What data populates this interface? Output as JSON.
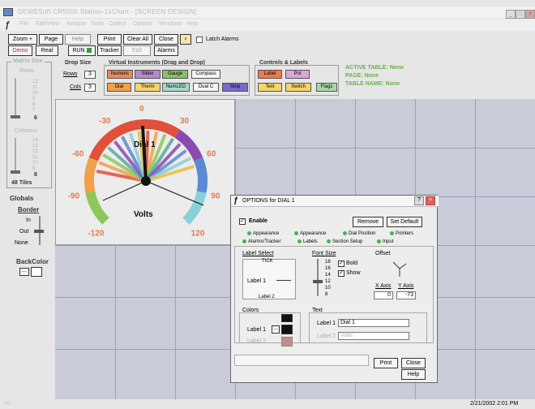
{
  "window": {
    "title": "DEWESoft CR5000 Station-1xChart - [SCREEN DESIGN]",
    "controls": [
      "_",
      "□",
      "×"
    ]
  },
  "menu": [
    "File",
    "Edit/View",
    "Analyze",
    "Tools",
    "Collect",
    "Options",
    "Windows",
    "Help"
  ],
  "toolbar": {
    "zoom": "Zoom +",
    "page": "Page",
    "help": "Help",
    "print": "Print",
    "clear_all": "Clear All",
    "close": "Close",
    "latch_alarms": "Latch Alarms",
    "demo": "Demo",
    "real": "Real",
    "run": "RUN",
    "tracker": "Tracker",
    "edit": "Edit",
    "alarms": "Alarms"
  },
  "matrix": {
    "label": "Matrix Size",
    "rows_label": "Rows",
    "cols_label": "Columns",
    "rows_ticks": [
      "12",
      "11",
      "10",
      "9",
      "8",
      "7"
    ],
    "rows_value": "6",
    "cols_ticks": [
      "14",
      "13",
      "12",
      "11",
      "10",
      "9"
    ],
    "cols_value": "8",
    "tiles": "48 Tiles"
  },
  "drop_size": {
    "label": "Drop Size",
    "rows_label": "Rows",
    "rows": "3",
    "cols_label": "Cols",
    "cols": "3"
  },
  "virtual_instruments": {
    "label": "Virtual Instruments (Drag and Drop)",
    "items": [
      {
        "label": "Numeric",
        "color": "#e98a5a"
      },
      {
        "label": "Slider",
        "color": "#b58ac9"
      },
      {
        "label": "Gauge",
        "color": "#8bbf6a"
      },
      {
        "label": "Compass",
        "color": "#f4f4f4"
      },
      {
        "label": "Dial",
        "color": "#f0a04a"
      },
      {
        "label": "Therm",
        "color": "#f6d36c"
      },
      {
        "label": "NumLED",
        "color": "#a8d8c8"
      },
      {
        "label": "Dual C",
        "color": "#f4f4f4"
      },
      {
        "label": "Strip",
        "color": "#7a68c8"
      }
    ]
  },
  "controls_labels": {
    "label": "Controls & Labels",
    "items": [
      {
        "label": "Label",
        "color": "#f07a4a"
      },
      {
        "label": "Pot",
        "color": "#d8a8d8"
      },
      {
        "label": "Text",
        "color": "#f6d36c"
      },
      {
        "label": "Switch",
        "color": "#f6d36c"
      },
      {
        "label": "Flags",
        "color": "#a8d8a8"
      }
    ]
  },
  "active_info": {
    "table": "ACTIVE TABLE: None",
    "page": "PAGE: None",
    "table_name": "TABLE NAME: None"
  },
  "globals": {
    "label": "Globals",
    "border": "Border",
    "in": "In",
    "out": "Out",
    "none": "None",
    "backcolor": "BackColor"
  },
  "dial": {
    "title": "Dial 1",
    "units": "Volts",
    "ticks": [
      "-120",
      "-90",
      "-60",
      "-30",
      "0",
      "30",
      "60",
      "90",
      "120"
    ],
    "needle_value": -3
  },
  "options": {
    "title": "OPTIONS for DIAL 1",
    "enable": "Enable",
    "remove": "Remove",
    "set_default": "Set Default",
    "tabs_row1": [
      "Appearance",
      "Appearance",
      "Dial Position",
      "Pointers"
    ],
    "tabs_row2": [
      "Alarms/Tracker",
      "Labels",
      "Section Setup",
      "Input"
    ],
    "label_select": "Label Select",
    "tick": "TICK",
    "label1": "Label 1",
    "label2": "Label 2",
    "font_size": "Font Size",
    "sizes": [
      "18",
      "16",
      "14",
      "12",
      "10",
      "8"
    ],
    "bold": "Bold",
    "show": "Show",
    "offset": "Offset",
    "x_axis": "X Axis",
    "y_axis": "Y Axis",
    "x_val": "0",
    "y_val": "-73",
    "colors": "Colors",
    "colors_label1": "Label 1",
    "colors_label2": "Label 2",
    "text": "Text",
    "text_label1": "Label 1",
    "text_value1": "Dial 1",
    "text_label2": "Label 2",
    "text_value2": "Volts",
    "print": "Print",
    "close": "Close",
    "help": "Help"
  },
  "status": {
    "datetime": "2/21/2002  2:01 PM"
  }
}
